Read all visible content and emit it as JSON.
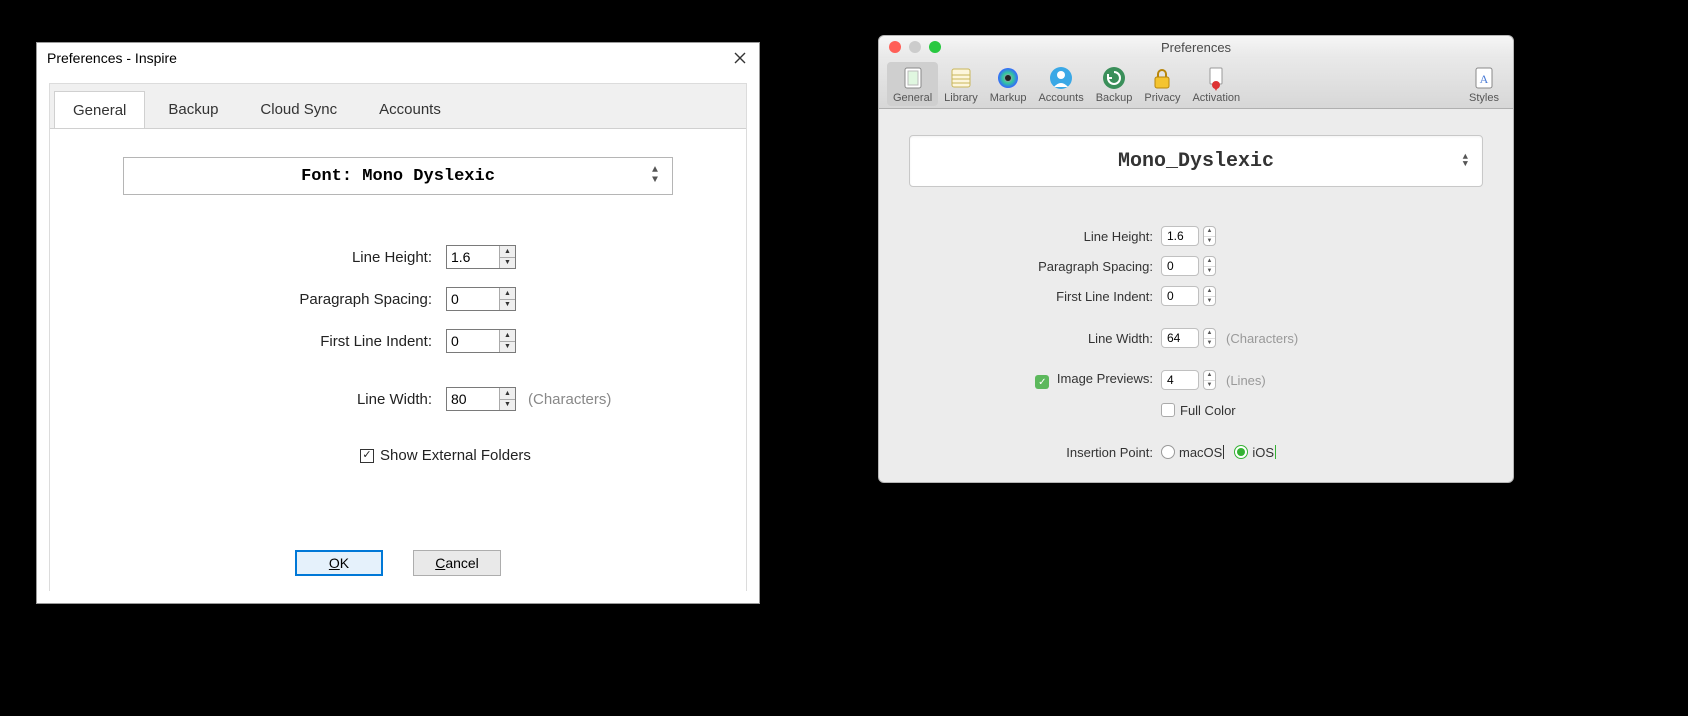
{
  "win": {
    "title": "Preferences - Inspire",
    "tabs": [
      "General",
      "Backup",
      "Cloud Sync",
      "Accounts"
    ],
    "font_label": "Font: Mono Dyslexic",
    "rows": {
      "line_height_label": "Line Height:",
      "line_height_value": "1.6",
      "paragraph_spacing_label": "Paragraph Spacing:",
      "paragraph_spacing_value": "0",
      "first_line_indent_label": "First Line Indent:",
      "first_line_indent_value": "0",
      "line_width_label": "Line Width:",
      "line_width_value": "80",
      "line_width_hint": "(Characters)"
    },
    "show_external_label": "Show External Folders",
    "ok_label": "OK",
    "cancel_label": "Cancel",
    "cancel_prefix": "C",
    "cancel_rest": "ancel",
    "ok_prefix": "O",
    "ok_rest": "K"
  },
  "mac": {
    "title": "Preferences",
    "toolbar": {
      "general": "General",
      "library": "Library",
      "markup": "Markup",
      "accounts": "Accounts",
      "backup": "Backup",
      "privacy": "Privacy",
      "activation": "Activation",
      "styles": "Styles"
    },
    "font_label": "Mono_Dyslexic",
    "rows": {
      "line_height_label": "Line Height:",
      "line_height_value": "1.6",
      "paragraph_spacing_label": "Paragraph Spacing:",
      "paragraph_spacing_value": "0",
      "first_line_indent_label": "First Line Indent:",
      "first_line_indent_value": "0",
      "line_width_label": "Line Width:",
      "line_width_value": "64",
      "line_width_hint": "(Characters)",
      "image_previews_label": "Image Previews:",
      "image_previews_value": "4",
      "image_previews_hint": "(Lines)",
      "full_color_label": "Full Color",
      "insertion_point_label": "Insertion Point:",
      "insertion_macos": "macOS",
      "insertion_ios": "iOS"
    }
  }
}
